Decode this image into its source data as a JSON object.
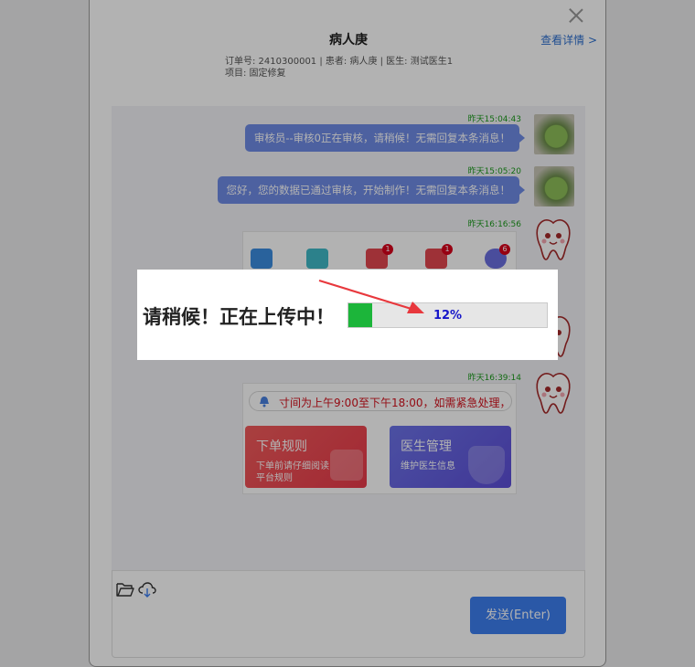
{
  "dialog": {
    "title": "病人庚",
    "detail_link": "查看详情 >",
    "order_line": "订单号: 2410300001 | 患者:  病人庚  | 医生:  测试医生1",
    "project_line": "项目:  固定修复"
  },
  "messages": [
    {
      "time": "昨天15:04:43",
      "text": "审核员--审核0正在审核，请稍候！无需回复本条消息！"
    },
    {
      "time": "昨天15:05:20",
      "text": "您好，您的数据已通过审核，开始制作！无需回复本条消息！"
    },
    {
      "time": "昨天16:16:56",
      "text": ""
    },
    {
      "time": "昨天16:39:14",
      "text": ""
    }
  ],
  "app_icons": [
    {
      "name": "mail-icon",
      "color": "#3b8de0",
      "badge": ""
    },
    {
      "name": "document-icon",
      "color": "#3fb9c8",
      "badge": ""
    },
    {
      "name": "calendar-icon",
      "color": "#e2474f",
      "badge": "1"
    },
    {
      "name": "check-icon",
      "color": "#e2474f",
      "badge": "1"
    },
    {
      "name": "shield-icon",
      "color": "#6b6fe0",
      "badge": "6"
    }
  ],
  "notice": {
    "text": "寸间为上午9:00至下午18:00，如需紧急处理，"
  },
  "tiles": [
    {
      "title": "下单规则",
      "sub1": "下单前请仔细阅读",
      "sub2": "平台规则"
    },
    {
      "title": "医生管理",
      "sub1": "维护医生信息",
      "sub2": ""
    }
  ],
  "input": {
    "send_label": "发送(Enter)"
  },
  "loading": {
    "text": "请稍候！正在上传中！",
    "progress_label": "12%",
    "progress_fraction": 0.12
  },
  "colors": {
    "accent": "#3d7ef0",
    "bubble": "#6f8be6",
    "timestamp": "#1c9a1c",
    "progress": "#1cb53a",
    "arrow": "#e8383d"
  }
}
